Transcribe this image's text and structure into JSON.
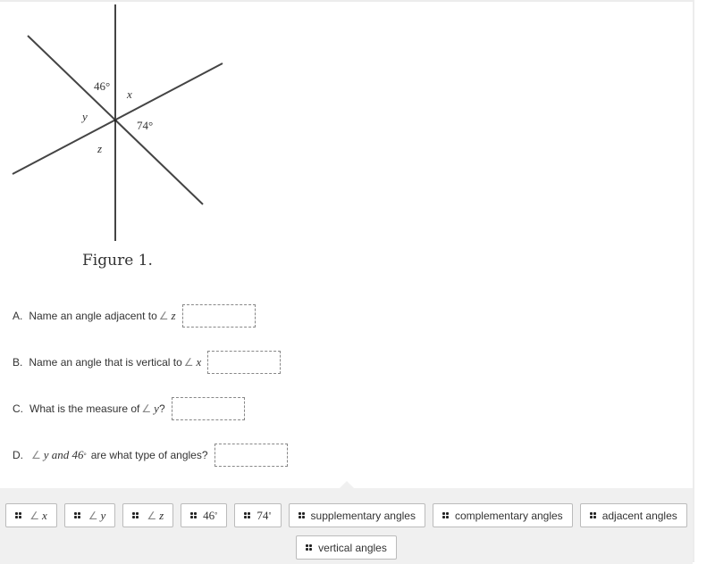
{
  "figure": {
    "labels": {
      "angle_46": "46°",
      "angle_x": "x",
      "angle_y": "y",
      "angle_74": "74°",
      "angle_z": "z"
    },
    "caption": "Figure 1."
  },
  "questions": [
    {
      "letter": "A.",
      "text": "Name an angle adjacent to",
      "symbol": "∠",
      "var": "z",
      "suffix": "",
      "answer": ""
    },
    {
      "letter": "B.",
      "text": "Name an angle that is vertical to",
      "symbol": "∠",
      "var": "x",
      "suffix": "",
      "answer": ""
    },
    {
      "letter": "C.",
      "text": "What is the measure of",
      "symbol": "∠",
      "var": "y",
      "suffix": "?",
      "answer": ""
    },
    {
      "letter": "D.",
      "symbol": "∠",
      "math": "y and 46",
      "degree": "°",
      "text": "are what type of angles?",
      "answer": ""
    }
  ],
  "choices": [
    {
      "symbol": "∠",
      "var": "x"
    },
    {
      "symbol": "∠",
      "var": "y"
    },
    {
      "symbol": "∠",
      "var": "z"
    },
    {
      "num": "46",
      "degree": "°"
    },
    {
      "num": "74",
      "degree": "°"
    },
    {
      "label": "supplementary angles"
    },
    {
      "label": "complementary angles"
    },
    {
      "label": "adjacent angles"
    },
    {
      "label": "vertical angles"
    }
  ]
}
